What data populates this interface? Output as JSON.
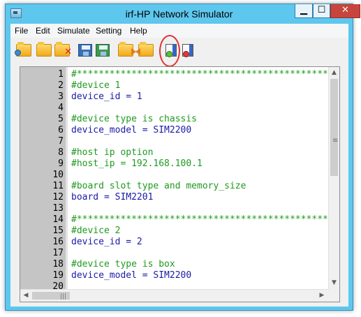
{
  "window": {
    "title": "irf-HP Network Simulator",
    "minimize_glyph": "▁",
    "maximize_glyph": "☐",
    "close_glyph": "✕"
  },
  "menu": {
    "items": [
      "File",
      "Edit",
      "Simulate",
      "Setting",
      "Help"
    ]
  },
  "toolbar": {
    "buttons": [
      "new-config-icon",
      "open-folder-icon",
      "close-file-icon",
      "save-icon",
      "save-as-icon",
      "export-icon",
      "import-icon",
      "start-simulation-icon",
      "stop-simulation-icon"
    ],
    "highlighted_button": "start-simulation-icon",
    "highlight_color": "#e03232"
  },
  "editor": {
    "lines": [
      {
        "n": "1",
        "text": "#**************************************************",
        "type": "comment"
      },
      {
        "n": "2",
        "text": "#device 1",
        "type": "comment"
      },
      {
        "n": "3",
        "text": "device_id = 1",
        "type": "normal"
      },
      {
        "n": "4",
        "text": "",
        "type": "normal"
      },
      {
        "n": "5",
        "text": "#device type is chassis",
        "type": "comment"
      },
      {
        "n": "6",
        "text": "device_model = SIM2200",
        "type": "normal"
      },
      {
        "n": "7",
        "text": "",
        "type": "normal"
      },
      {
        "n": "8",
        "text": "#host ip option",
        "type": "comment"
      },
      {
        "n": "9",
        "text": "#host_ip = 192.168.100.1",
        "type": "comment"
      },
      {
        "n": "10",
        "text": "",
        "type": "normal"
      },
      {
        "n": "11",
        "text": "#board slot type and memory_size",
        "type": "comment"
      },
      {
        "n": "12",
        "text": "board = SIM2201",
        "type": "normal"
      },
      {
        "n": "13",
        "text": "",
        "type": "normal"
      },
      {
        "n": "14",
        "text": "#**************************************************",
        "type": "comment"
      },
      {
        "n": "15",
        "text": "#device 2",
        "type": "comment"
      },
      {
        "n": "16",
        "text": "device_id = 2",
        "type": "normal"
      },
      {
        "n": "17",
        "text": "",
        "type": "normal"
      },
      {
        "n": "18",
        "text": "#device type is box",
        "type": "comment"
      },
      {
        "n": "19",
        "text": "device_model = SIM2200",
        "type": "normal"
      },
      {
        "n": "20",
        "text": "",
        "type": "normal"
      }
    ]
  },
  "scrollbars": {
    "up": "▲",
    "down": "▼",
    "left": "◀",
    "right": "▶",
    "v_grip": "≡",
    "h_grip": "|||"
  },
  "colors": {
    "comment": "#1f9a1f",
    "code": "#1a1aa8",
    "titlebar": "#5ec7ee",
    "gutter": "#c5c5c5"
  }
}
